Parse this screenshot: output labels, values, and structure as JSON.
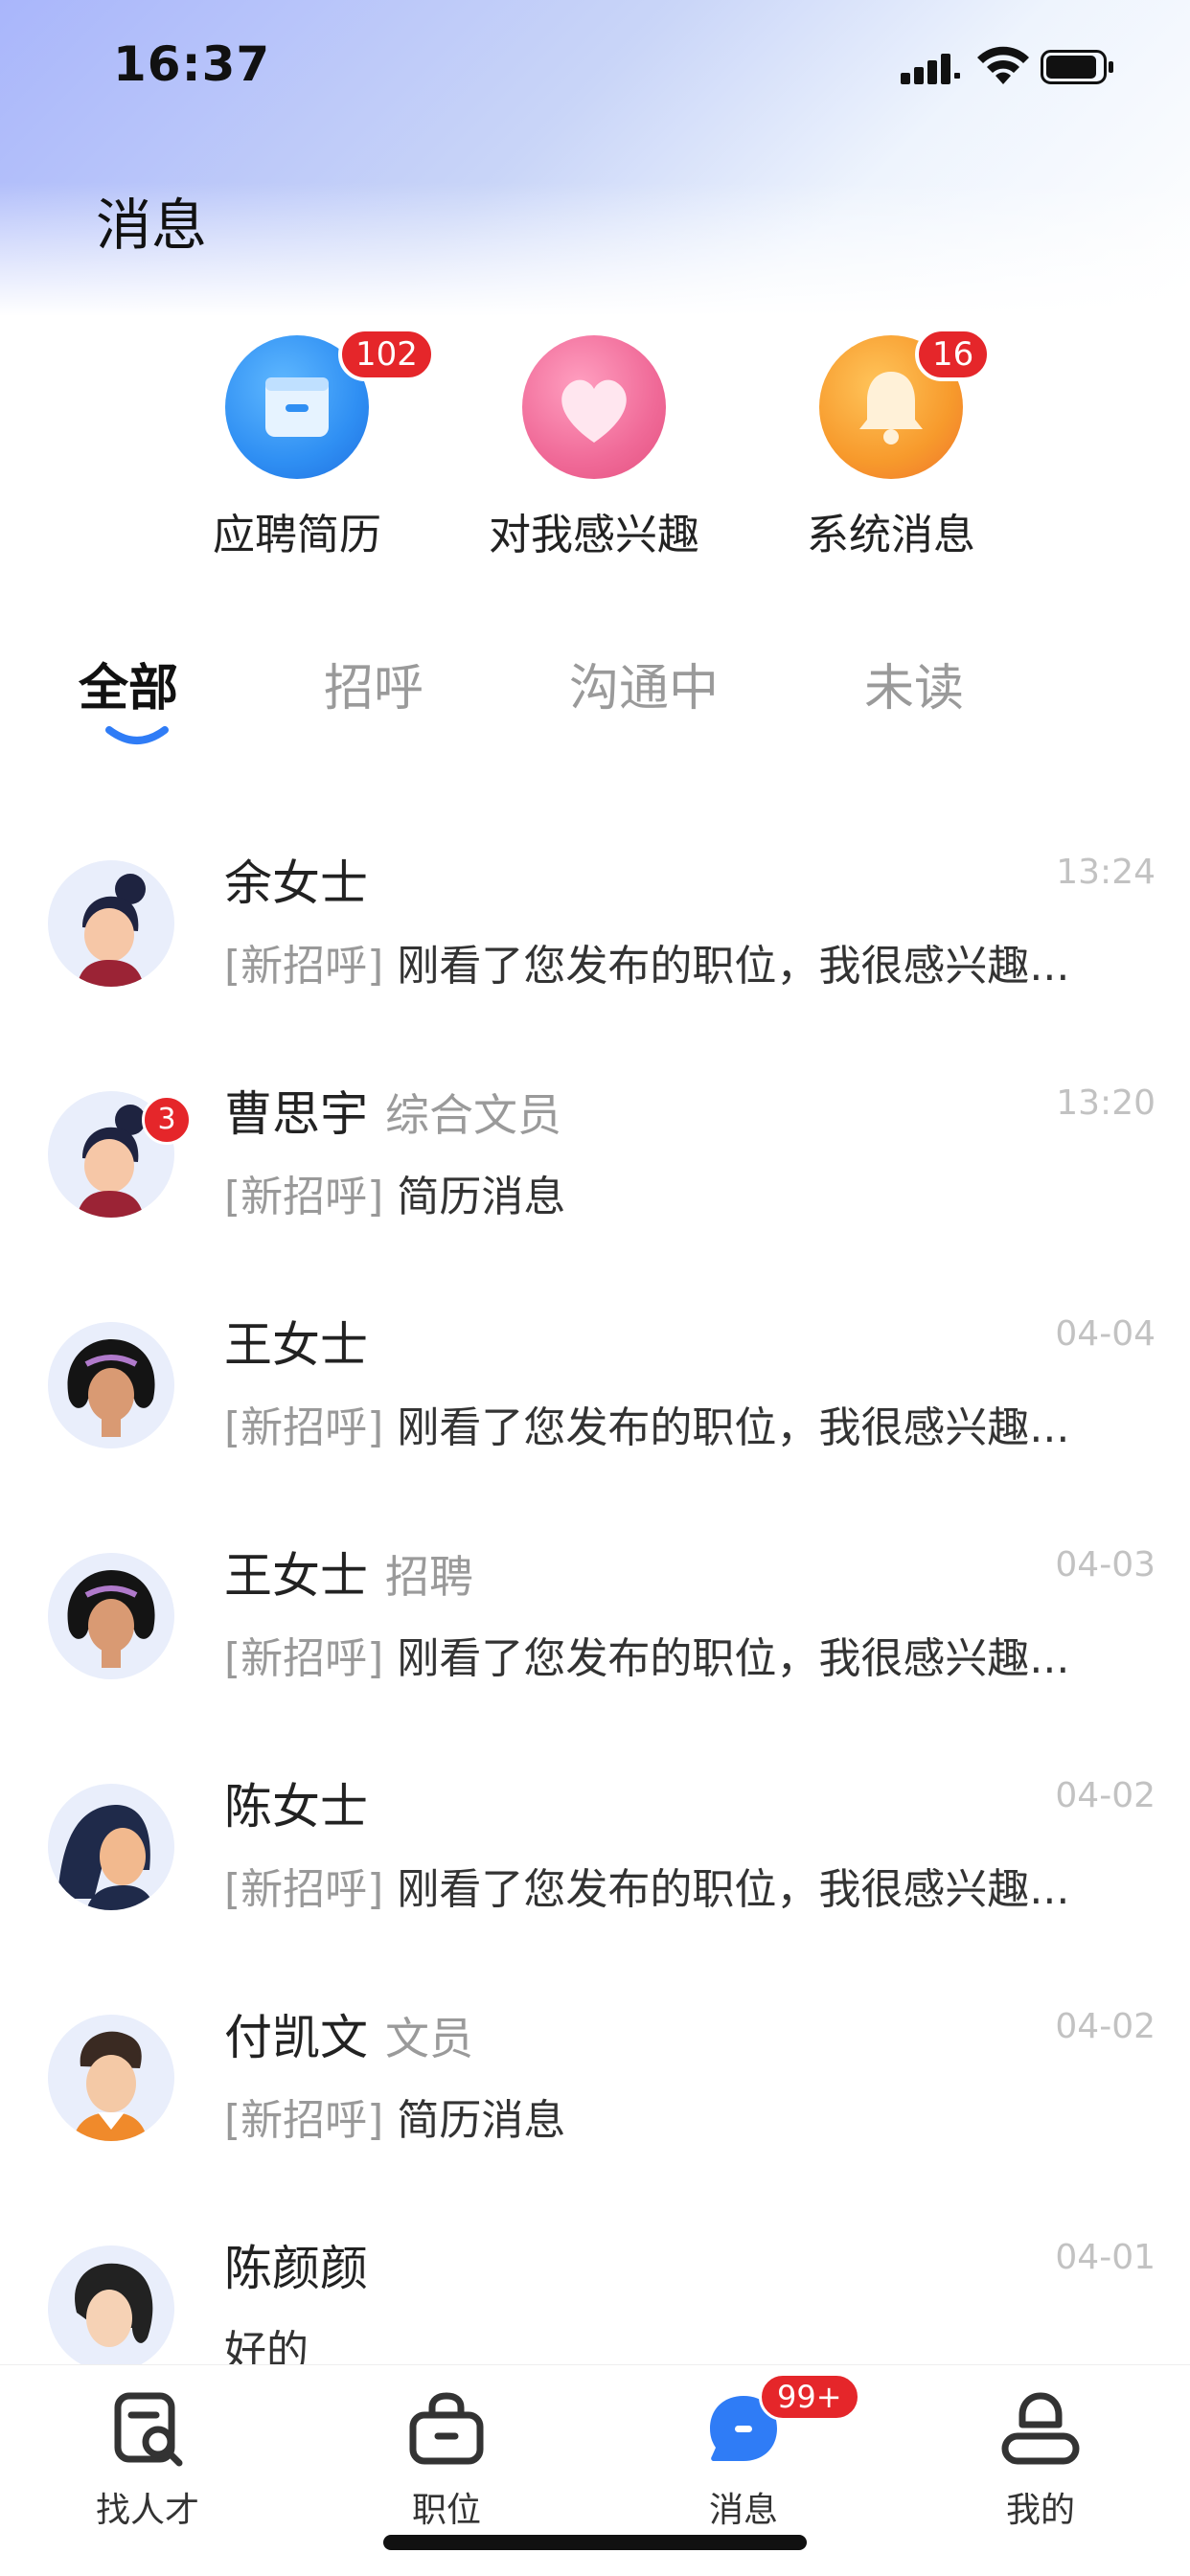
{
  "status_bar": {
    "time": "16:37"
  },
  "header": {
    "title": "消息"
  },
  "categories": [
    {
      "label": "应聘简历",
      "badge": "102",
      "icon": "resume-folder-icon",
      "color": "#2f8ff3"
    },
    {
      "label": "对我感兴趣",
      "badge": "",
      "icon": "heart-icon",
      "color": "#f06090"
    },
    {
      "label": "系统消息",
      "badge": "16",
      "icon": "bell-icon",
      "color": "#f59a2b"
    }
  ],
  "tabs": [
    {
      "label": "全部",
      "active": true
    },
    {
      "label": "招呼",
      "active": false
    },
    {
      "label": "沟通中",
      "active": false
    },
    {
      "label": "未读",
      "active": false
    }
  ],
  "messages": [
    {
      "name": "余女士",
      "role": "",
      "time": "13:24",
      "tag": "[新招呼]",
      "preview": "刚看了您发布的职位，我很感兴趣...",
      "unread": ""
    },
    {
      "name": "曹思宇",
      "role": "综合文员",
      "time": "13:20",
      "tag": "[新招呼]",
      "preview": "简历消息",
      "unread": "3"
    },
    {
      "name": "王女士",
      "role": "",
      "time": "04-04",
      "tag": "[新招呼]",
      "preview": "刚看了您发布的职位，我很感兴趣...",
      "unread": ""
    },
    {
      "name": "王女士",
      "role": "招聘",
      "time": "04-03",
      "tag": "[新招呼]",
      "preview": "刚看了您发布的职位，我很感兴趣...",
      "unread": ""
    },
    {
      "name": "陈女士",
      "role": "",
      "time": "04-02",
      "tag": "[新招呼]",
      "preview": "刚看了您发布的职位，我很感兴趣...",
      "unread": ""
    },
    {
      "name": "付凯文",
      "role": "文员",
      "time": "04-02",
      "tag": "[新招呼]",
      "preview": "简历消息",
      "unread": ""
    },
    {
      "name": "陈颜颜",
      "role": "",
      "time": "04-01",
      "tag": "",
      "preview": "好的",
      "unread": ""
    }
  ],
  "bottom_nav": [
    {
      "label": "找人才",
      "icon": "find-talent-icon",
      "active": false
    },
    {
      "label": "职位",
      "icon": "briefcase-icon",
      "active": false
    },
    {
      "label": "消息",
      "icon": "chat-bubble-icon",
      "active": true,
      "badge": "99+"
    },
    {
      "label": "我的",
      "icon": "profile-icon",
      "active": false
    }
  ],
  "colors": {
    "accent": "#2f7cf6",
    "badge": "#e5262a",
    "muted": "#9a9a9a"
  }
}
